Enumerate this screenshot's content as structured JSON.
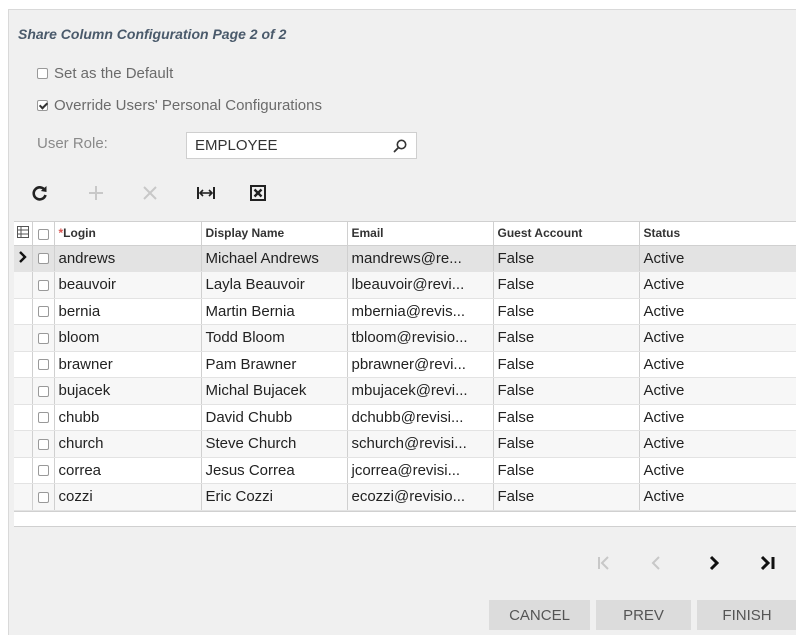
{
  "title": "Share Column Configuration Page 2 of 2",
  "options": {
    "set_default": {
      "label": "Set as the Default",
      "checked": false
    },
    "override": {
      "label": "Override Users' Personal Configurations",
      "checked": true
    }
  },
  "user_role": {
    "label": "User Role:",
    "value": "EMPLOYEE"
  },
  "toolbar": {
    "icons": [
      "refresh-icon",
      "add-icon",
      "delete-icon",
      "fit-columns-icon",
      "export-excel-icon"
    ]
  },
  "grid": {
    "columns": {
      "login": "Login",
      "display_name": "Display Name",
      "email": "Email",
      "guest_account": "Guest Account",
      "status": "Status"
    },
    "required_marker": "*",
    "rows": [
      [
        "andrews",
        "Michael Andrews",
        "mandrews@re...",
        "False",
        "Active"
      ],
      [
        "beauvoir",
        "Layla Beauvoir",
        "lbeauvoir@revi...",
        "False",
        "Active"
      ],
      [
        "bernia",
        "Martin Bernia",
        "mbernia@revis...",
        "False",
        "Active"
      ],
      [
        "bloom",
        "Todd Bloom",
        "tbloom@revisio...",
        "False",
        "Active"
      ],
      [
        "brawner",
        "Pam Brawner",
        "pbrawner@revi...",
        "False",
        "Active"
      ],
      [
        "bujacek",
        "Michal Bujacek",
        "mbujacek@revi...",
        "False",
        "Active"
      ],
      [
        "chubb",
        "David Chubb",
        "dchubb@revisi...",
        "False",
        "Active"
      ],
      [
        "church",
        "Steve Church",
        "schurch@revisi...",
        "False",
        "Active"
      ],
      [
        "correa",
        "Jesus Correa",
        "jcorrea@revisi...",
        "False",
        "Active"
      ],
      [
        "cozzi",
        "Eric Cozzi",
        "ecozzi@revisio...",
        "False",
        "Active"
      ]
    ],
    "selected_row": 0
  },
  "pager": {
    "first": "|<",
    "prev": "<",
    "next": ">",
    "last": ">|"
  },
  "buttons": {
    "cancel": "CANCEL",
    "prev": "PREV",
    "finish": "FINISH"
  },
  "colors": {
    "title": "#4a5a6b",
    "required": "#d9534f",
    "button_bg": "#dcdcdc",
    "selected_row": "#e3e3e3"
  }
}
